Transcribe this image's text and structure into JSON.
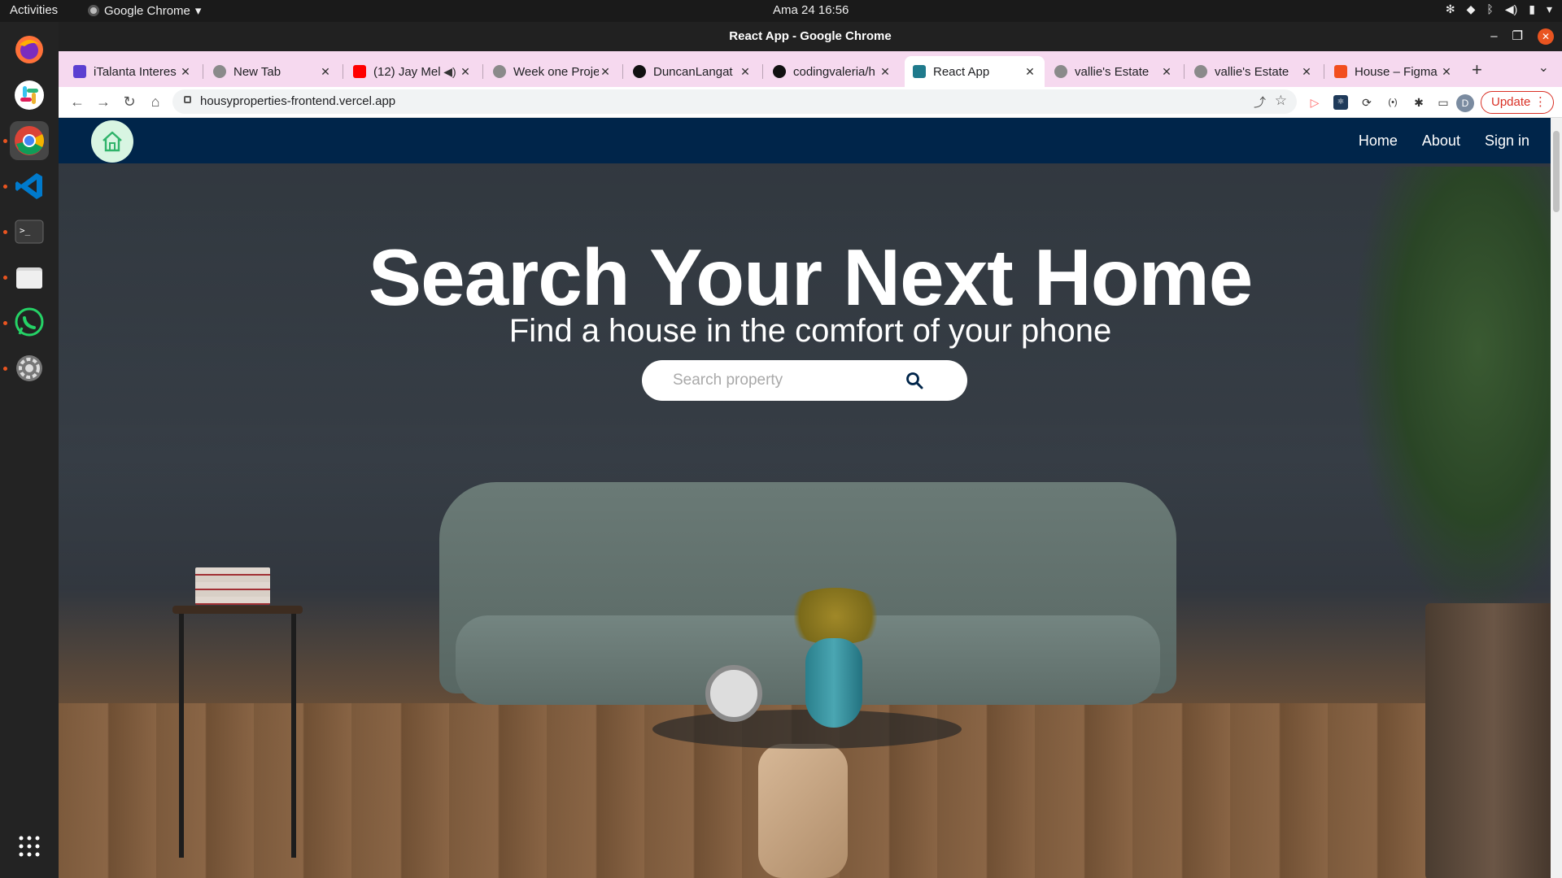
{
  "system": {
    "activities": "Activities",
    "app_name": "Google Chrome",
    "clock": "Ama 24  16:56"
  },
  "window": {
    "title": "React App - Google Chrome"
  },
  "tabs": [
    {
      "label": "iTalanta Interes",
      "color": "#5b3fd1"
    },
    {
      "label": "New Tab",
      "color": "#8a8a8a"
    },
    {
      "label": "(12) Jay Mel",
      "color": "#ff0000"
    },
    {
      "label": "Week one Proje",
      "color": "#8a8a8a"
    },
    {
      "label": "DuncanLangat",
      "color": "#111111"
    },
    {
      "label": "codingvaleria/h",
      "color": "#111111"
    },
    {
      "label": "React App",
      "color": "#1f7a8c"
    },
    {
      "label": "vallie's Estate",
      "color": "#8a8a8a"
    },
    {
      "label": "vallie's Estate",
      "color": "#8a8a8a"
    },
    {
      "label": "House – Figma",
      "color": "#f24e1e"
    }
  ],
  "toolbar": {
    "url": "housyproperties-frontend.vercel.app",
    "update_label": "Update",
    "profile_initial": "D"
  },
  "site": {
    "nav": {
      "home": "Home",
      "about": "About",
      "signin": "Sign in"
    },
    "hero": {
      "title": "Search Your Next Home",
      "subtitle": "Find a house in the comfort of your phone",
      "search_placeholder": "Search property"
    },
    "colors": {
      "navbar": "#00254a",
      "logo_bg": "#d8f5e2",
      "logo_icon": "#2fb36a"
    }
  }
}
